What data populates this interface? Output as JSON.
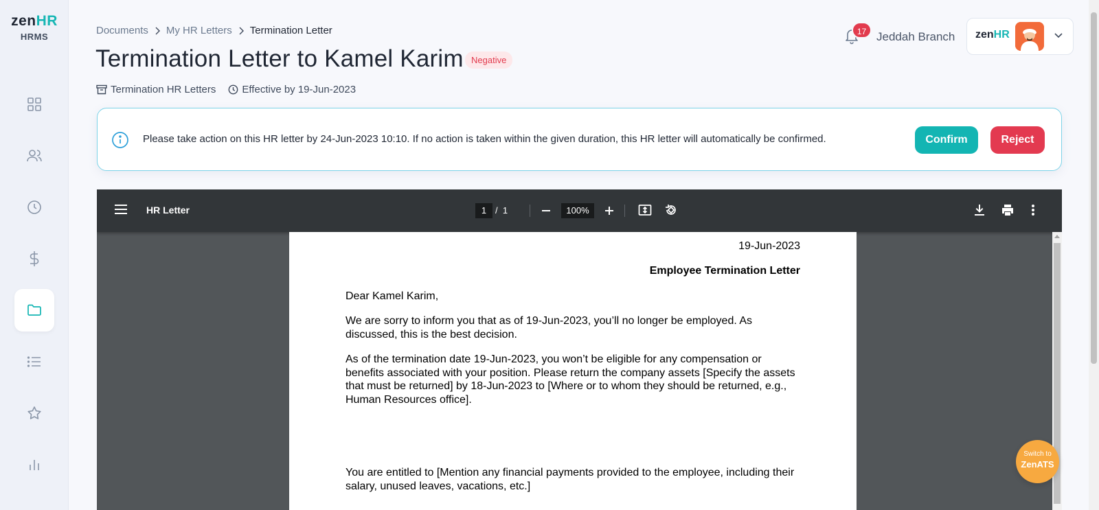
{
  "brand": {
    "logo_zen": "zen",
    "logo_hr": "HR",
    "product": "HRMS"
  },
  "sidebar": {
    "items": [
      {
        "icon": "dashboard-icon"
      },
      {
        "icon": "people-icon"
      },
      {
        "icon": "clock-icon"
      },
      {
        "icon": "dollar-icon"
      },
      {
        "icon": "folder-icon",
        "active": true
      },
      {
        "icon": "list-icon"
      },
      {
        "icon": "star-icon"
      },
      {
        "icon": "bar-chart-icon"
      }
    ]
  },
  "breadcrumb": {
    "items": [
      "Documents",
      "My HR Letters"
    ],
    "current": "Termination Letter"
  },
  "page": {
    "title": "Termination Letter to Kamel Karim",
    "badge": "Negative",
    "category": "Termination HR Letters",
    "effective": "Effective by 19-Jun-2023"
  },
  "header": {
    "notification_count": "17",
    "branch": "Jeddah Branch",
    "profile_logo_zen": "zen",
    "profile_logo_hr": "HR"
  },
  "alert": {
    "text": "Please take action on this HR letter by 24-Jun-2023 10:10. If no action is taken within the given duration, this HR letter will automatically be confirmed.",
    "confirm_label": "Confirm",
    "reject_label": "Reject"
  },
  "viewer": {
    "title": "HR Letter",
    "current_page": "1",
    "page_separator": "/",
    "total_pages": "1",
    "zoom": "100%"
  },
  "letter": {
    "date": "19-Jun-2023",
    "heading": "Employee Termination Letter",
    "greeting": "Dear Kamel Karim,",
    "para1": "We are sorry to inform you that as of 19-Jun-2023, you’ll no longer be employed. As discussed, this is the best decision.",
    "para2": "As of the termination date 19-Jun-2023, you won’t be eligible for any compensation or benefits associated with your position. Please return the company assets [Specify the assets that must be returned] by 18-Jun-2023 to [Where or to whom they should be returned, e.g., Human Resources office].",
    "para3": "You are entitled to [Mention any financial payments provided to the employee, including their salary, unused leaves, vacations, etc.]"
  },
  "fab": {
    "line1": "Switch to",
    "line2": "ZenATS"
  },
  "colors": {
    "accent": "#13b5b3",
    "danger": "#e33a50",
    "badge_bg": "#fde8ea",
    "fab": "#f7a940"
  }
}
